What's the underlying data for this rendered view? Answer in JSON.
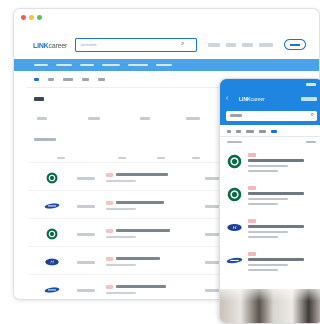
{
  "desktop": {
    "window_controls": {
      "close_color": "#f25b5b",
      "minimize_color": "#f7c33d",
      "maximize_color": "#4cc763"
    },
    "logo": {
      "brand": "LINK",
      "suffix": "career"
    },
    "search": {
      "value": "Jobkorea"
    },
    "accent_color": "#1e74d6",
    "menu_bar_color": "#4aa3e8",
    "results": [
      {
        "company_logo": "starbucks-logo"
      },
      {
        "company_logo": "samsung-logo"
      },
      {
        "company_logo": "starbucks-logo"
      },
      {
        "company_logo": "hyundai-logo"
      },
      {
        "company_logo": "samsung-logo"
      }
    ]
  },
  "mobile": {
    "logo": {
      "brand": "LINK",
      "suffix": "career"
    },
    "header_color": "#1e86e0",
    "results": [
      {
        "company_logo": "starbucks-logo"
      },
      {
        "company_logo": "starbucks-logo"
      },
      {
        "company_logo": "hyundai-logo"
      },
      {
        "company_logo": "samsung-logo"
      }
    ]
  }
}
